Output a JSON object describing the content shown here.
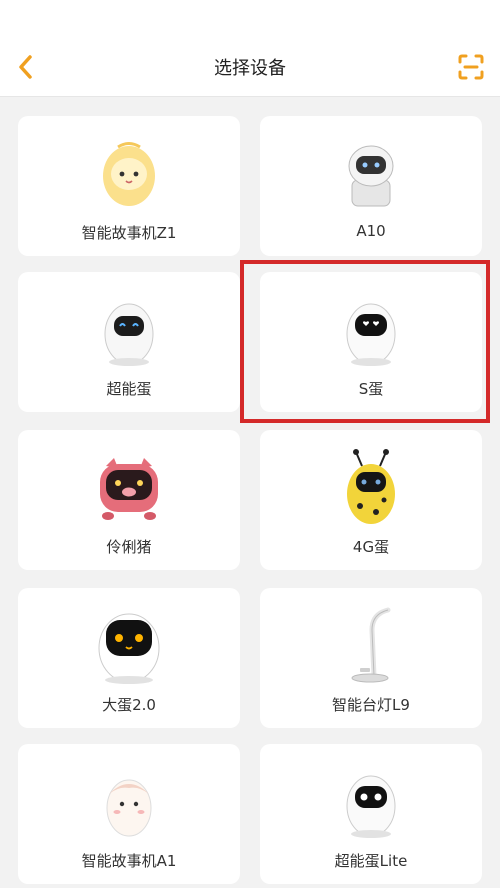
{
  "header": {
    "title": "选择设备",
    "back_icon": "chevron-left-icon",
    "scan_icon": "scan-icon",
    "accent_color": "#f0a020"
  },
  "devices": [
    {
      "label": "智能故事机Z1",
      "icon": "egg-character-icon"
    },
    {
      "label": "A10",
      "icon": "robot-a10-icon"
    },
    {
      "label": "超能蛋",
      "icon": "egg-robot-icon"
    },
    {
      "label": "S蛋",
      "icon": "egg-robot-s-icon"
    },
    {
      "label": "伶俐猪",
      "icon": "pig-robot-icon"
    },
    {
      "label": "4G蛋",
      "icon": "bee-egg-robot-icon"
    },
    {
      "label": "大蛋2.0",
      "icon": "big-egg-robot-icon"
    },
    {
      "label": "智能台灯L9",
      "icon": "desk-lamp-icon"
    },
    {
      "label": "智能故事机A1",
      "icon": "egg-character-a1-icon"
    },
    {
      "label": "超能蛋Lite",
      "icon": "egg-robot-lite-icon"
    }
  ],
  "highlight_color": "#d42a2a"
}
